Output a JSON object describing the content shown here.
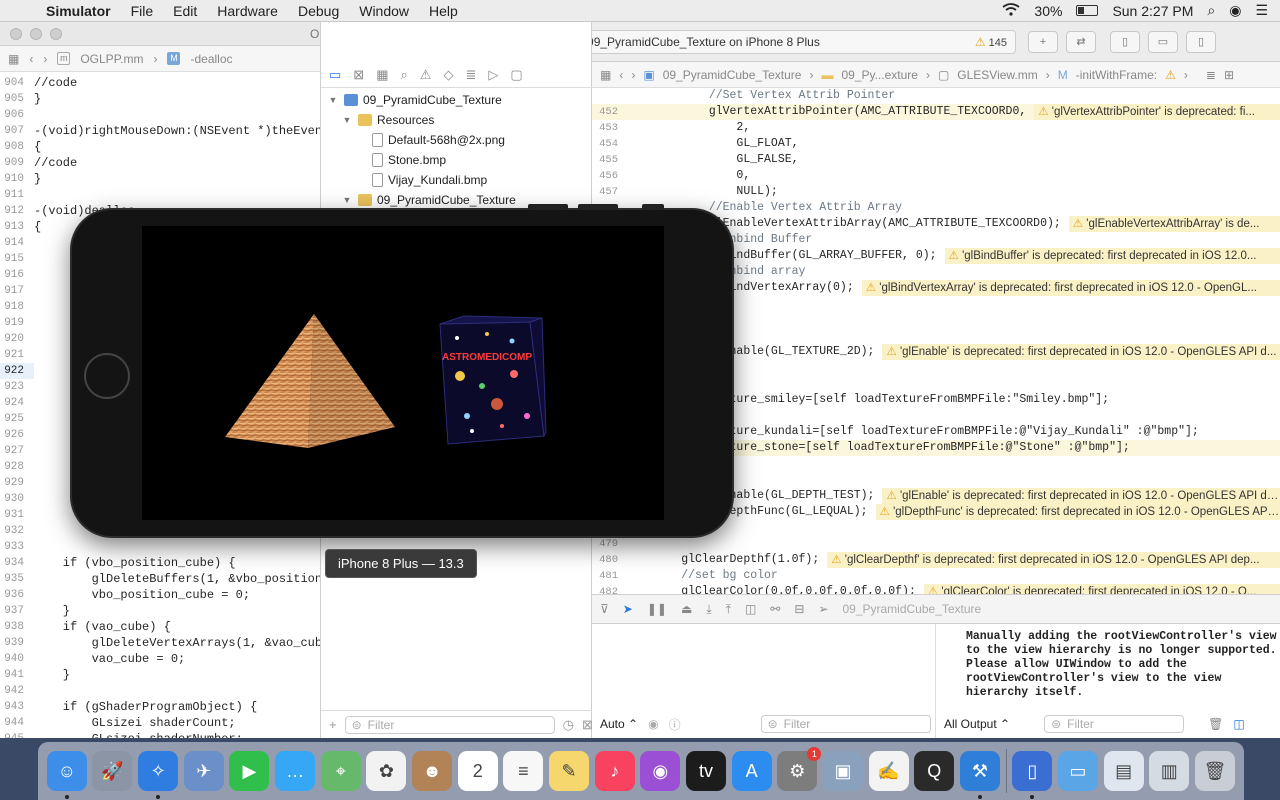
{
  "menubar": {
    "app": "Simulator",
    "menus": [
      "File",
      "Edit",
      "Hardware",
      "Debug",
      "Window",
      "Help"
    ],
    "battery": "30%",
    "clock": "Sun 2:27 PM"
  },
  "left_editor": {
    "title": "OG",
    "breadcrumb_file": "OGLPP.mm",
    "breadcrumb_symbol": "-dealloc",
    "lines": [
      {
        "n": "904",
        "t": "//code"
      },
      {
        "n": "905",
        "t": "}"
      },
      {
        "n": "906",
        "t": ""
      },
      {
        "n": "907",
        "t": "-(void)rightMouseDown:(NSEvent *)theEvent"
      },
      {
        "n": "908",
        "t": "{"
      },
      {
        "n": "909",
        "t": "//code"
      },
      {
        "n": "910",
        "t": "}"
      },
      {
        "n": "911",
        "t": ""
      },
      {
        "n": "912",
        "t": "-(void)dealloc"
      },
      {
        "n": "913",
        "t": "{"
      },
      {
        "n": "914",
        "t": ""
      },
      {
        "n": "915",
        "t": ""
      },
      {
        "n": "916",
        "t": ""
      },
      {
        "n": "917",
        "t": ""
      },
      {
        "n": "918",
        "t": ""
      },
      {
        "n": "919",
        "t": ""
      },
      {
        "n": "920",
        "t": ""
      },
      {
        "n": "921",
        "t": ""
      },
      {
        "n": "922",
        "t": ""
      },
      {
        "n": "923",
        "t": ""
      },
      {
        "n": "924",
        "t": ""
      },
      {
        "n": "925",
        "t": ""
      },
      {
        "n": "926",
        "t": ""
      },
      {
        "n": "927",
        "t": ""
      },
      {
        "n": "928",
        "t": ""
      },
      {
        "n": "929",
        "t": ""
      },
      {
        "n": "930",
        "t": ""
      },
      {
        "n": "931",
        "t": ""
      },
      {
        "n": "932",
        "t": ""
      },
      {
        "n": "933",
        "t": ""
      },
      {
        "n": "934",
        "t": "    if (vbo_position_cube) {"
      },
      {
        "n": "935",
        "t": "        glDeleteBuffers(1, &vbo_position"
      },
      {
        "n": "936",
        "t": "        vbo_position_cube = 0;"
      },
      {
        "n": "937",
        "t": "    }"
      },
      {
        "n": "938",
        "t": "    if (vao_cube) {"
      },
      {
        "n": "939",
        "t": "        glDeleteVertexArrays(1, &vao_cub"
      },
      {
        "n": "940",
        "t": "        vao_cube = 0;"
      },
      {
        "n": "941",
        "t": "    }"
      },
      {
        "n": "942",
        "t": ""
      },
      {
        "n": "943",
        "t": "    if (gShaderProgramObject) {"
      },
      {
        "n": "944",
        "t": "        GLsizei shaderCount;"
      },
      {
        "n": "945",
        "t": "        GLsizei shaderNumber;"
      }
    ]
  },
  "toolbar": {
    "status": "Running 09_PyramidCube_Texture on iPhone 8 Plus",
    "warning_count": "145"
  },
  "navigator": {
    "tree": [
      {
        "label": "09_PyramidCube_Texture",
        "kind": "proj",
        "level": 0,
        "disc": "▼"
      },
      {
        "label": "Resources",
        "kind": "folder",
        "level": 1,
        "disc": "▼"
      },
      {
        "label": "Default-568h@2x.png",
        "kind": "file",
        "level": 2,
        "disc": ""
      },
      {
        "label": "Stone.bmp",
        "kind": "file",
        "level": 2,
        "disc": ""
      },
      {
        "label": "Vijay_Kundali.bmp",
        "kind": "file",
        "level": 2,
        "disc": ""
      },
      {
        "label": "09_PyramidCube_Texture",
        "kind": "folder",
        "level": 1,
        "disc": "▼"
      }
    ],
    "filter_placeholder": "Filter"
  },
  "right_editor": {
    "breadcrumb": [
      "09_PyramidCube_Texture",
      "09_Py...exture",
      "GLESView.mm",
      "-initWithFrame:"
    ],
    "lines": [
      {
        "n": "",
        "t": "            //Set Vertex Attrib Pointer",
        "c": true,
        "w": ""
      },
      {
        "n": "452",
        "t": "            glVertexAttribPointer(AMC_ATTRIBUTE_TEXCOORD0,",
        "w": "'glVertexAttribPointer' is deprecated: fi...",
        "hl": true
      },
      {
        "n": "453",
        "t": "                2,",
        "w": ""
      },
      {
        "n": "454",
        "t": "                GL_FLOAT,",
        "w": ""
      },
      {
        "n": "455",
        "t": "                GL_FALSE,",
        "w": ""
      },
      {
        "n": "456",
        "t": "                0,",
        "w": ""
      },
      {
        "n": "457",
        "t": "                NULL);",
        "w": ""
      },
      {
        "n": "",
        "t": "            //Enable Vertex Attrib Array",
        "c": true,
        "w": ""
      },
      {
        "n": "",
        "t": "            glEnableVertexAttribArray(AMC_ATTRIBUTE_TEXCOORD0);",
        "w": "'glEnableVertexAttribArray' is de..."
      },
      {
        "n": "",
        "t": "            //Unbind Buffer",
        "c": true,
        "w": ""
      },
      {
        "n": "",
        "t": "            glBindBuffer(GL_ARRAY_BUFFER, 0);",
        "w": "'glBindBuffer' is deprecated: first deprecated in iOS 12.0..."
      },
      {
        "n": "",
        "t": "            //Unbind array",
        "c": true,
        "w": ""
      },
      {
        "n": "",
        "t": "            glBindVertexArray(0);",
        "w": "'glBindVertexArray' is deprecated: first deprecated in iOS 12.0 - OpenGL..."
      },
      {
        "n": "",
        "t": "",
        "w": ""
      },
      {
        "n": "",
        "t": "",
        "w": ""
      },
      {
        "n": "",
        "t": "",
        "w": ""
      },
      {
        "n": "",
        "t": "            glEnable(GL_TEXTURE_2D);",
        "w": "'glEnable' is deprecated: first deprecated in iOS 12.0 - OpenGLES API d..."
      },
      {
        "n": "",
        "t": "",
        "w": ""
      },
      {
        "n": "",
        "t": "",
        "w": ""
      },
      {
        "n": "",
        "t": "            texture_smiley=[self loadTextureFromBMPFile:\"Smiley.bmp\"];",
        "w": ""
      },
      {
        "n": "",
        "t": "",
        "w": ""
      },
      {
        "n": "",
        "t": "            texture_kundali=[self loadTextureFromBMPFile:@\"Vijay_Kundali\" :@\"bmp\"];",
        "w": ""
      },
      {
        "n": "",
        "t": "            texture_stone=[self loadTextureFromBMPFile:@\"Stone\" :@\"bmp\"];",
        "w": "",
        "hl": true
      },
      {
        "n": "",
        "t": "",
        "w": ""
      },
      {
        "n": "",
        "t": "",
        "w": ""
      },
      {
        "n": "",
        "t": "            glEnable(GL_DEPTH_TEST);",
        "w": "'glEnable' is deprecated: first deprecated in iOS 12.0 - OpenGLES API dep..."
      },
      {
        "n": "",
        "t": "            glDepthFunc(GL_LEQUAL);",
        "w": "'glDepthFunc' is deprecated: first deprecated in iOS 12.0 - OpenGLES API d..."
      },
      {
        "n": "",
        "t": "",
        "w": ""
      },
      {
        "n": "479",
        "t": "",
        "w": ""
      },
      {
        "n": "480",
        "t": "        glClearDepthf(1.0f);",
        "w": "'glClearDepthf' is deprecated: first deprecated in iOS 12.0 - OpenGLES API dep..."
      },
      {
        "n": "481",
        "t": "        //set bg color",
        "c": true,
        "w": ""
      },
      {
        "n": "482",
        "t": "        glClearColor(0.0f,0.0f,0.0f,0.0f);",
        "w": "'glClearColor' is deprecated: first deprecated in iOS 12.0 - O..."
      }
    ]
  },
  "debug_bar": {
    "target": "09_PyramidCube_Texture"
  },
  "console": {
    "text": "Manually adding the rootViewController's view\nto the view hierarchy is no longer supported.\nPlease allow UIWindow to add the\nrootViewController's view to the view\nhierarchy itself.",
    "auto_label": "Auto",
    "output_label": "All Output",
    "filter_placeholder": "Filter"
  },
  "simulator": {
    "tooltip": "iPhone 8 Plus — 13.3",
    "cube_label": "ASTROMEDICOMP"
  },
  "dock": [
    {
      "name": "finder",
      "color": "#3d8ee8",
      "glyph": "☺",
      "dot": true
    },
    {
      "name": "launchpad",
      "color": "#8b95a6",
      "glyph": "🚀",
      "dot": false
    },
    {
      "name": "safari",
      "color": "#2f7de1",
      "glyph": "✧",
      "dot": true
    },
    {
      "name": "bird-app",
      "color": "#6b8fc9",
      "glyph": "✈",
      "dot": false
    },
    {
      "name": "facetime",
      "color": "#2fbf4a",
      "glyph": "▶",
      "dot": false
    },
    {
      "name": "messages",
      "color": "#35a7f5",
      "glyph": "…",
      "dot": false
    },
    {
      "name": "maps",
      "color": "#66b86a",
      "glyph": "⌖",
      "dot": false
    },
    {
      "name": "photos",
      "color": "#f2f2f2",
      "glyph": "✿",
      "dot": false
    },
    {
      "name": "contacts",
      "color": "#b28356",
      "glyph": "☻",
      "dot": false
    },
    {
      "name": "calendar",
      "color": "#ffffff",
      "glyph": "2",
      "dot": false
    },
    {
      "name": "reminders",
      "color": "#f7f7f7",
      "glyph": "≡",
      "dot": false
    },
    {
      "name": "notes",
      "color": "#f5d76e",
      "glyph": "✎",
      "dot": false
    },
    {
      "name": "music",
      "color": "#f8425f",
      "glyph": "♪",
      "dot": false
    },
    {
      "name": "podcasts",
      "color": "#9b4fd4",
      "glyph": "◉",
      "dot": false
    },
    {
      "name": "tv",
      "color": "#1c1c1c",
      "glyph": "tv",
      "dot": false
    },
    {
      "name": "app-store",
      "color": "#2d8cf0",
      "glyph": "A",
      "dot": false
    },
    {
      "name": "system-preferences",
      "color": "#7d7d7d",
      "glyph": "⚙",
      "dot": false,
      "badge": "1"
    },
    {
      "name": "preview",
      "color": "#8aa1bd",
      "glyph": "▣",
      "dot": false
    },
    {
      "name": "textedit",
      "color": "#f3f3f3",
      "glyph": "✍",
      "dot": false
    },
    {
      "name": "quicktime",
      "color": "#2a2a2a",
      "glyph": "Q",
      "dot": false
    },
    {
      "name": "xcode",
      "color": "#2f7fd8",
      "glyph": "⚒",
      "dot": true
    },
    {
      "name": "simulator",
      "color": "#3b6ed2",
      "glyph": "▯",
      "dot": true
    },
    {
      "name": "folder-1",
      "color": "#5aa5e6",
      "glyph": "▭",
      "dot": false
    },
    {
      "name": "folder-2",
      "color": "#dfe6ef",
      "glyph": "▤",
      "dot": false
    },
    {
      "name": "folder-3",
      "color": "#d5dbe3",
      "glyph": "▥",
      "dot": false
    },
    {
      "name": "trash",
      "color": "#c9ced6",
      "glyph": "🗑",
      "dot": false
    }
  ]
}
